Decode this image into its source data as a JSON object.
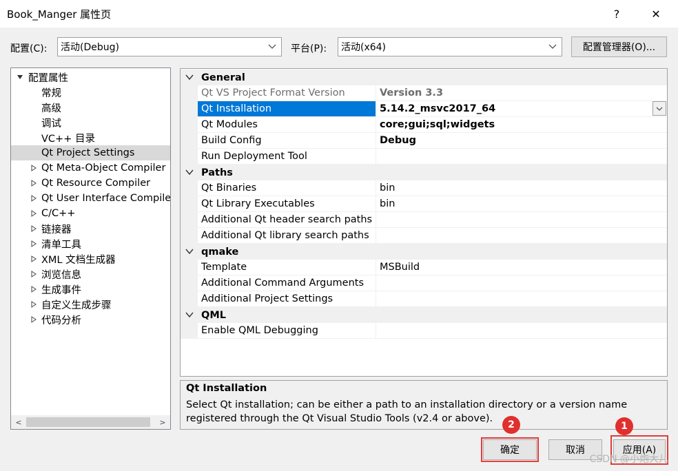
{
  "window": {
    "title": "Book_Manger 属性页",
    "help_label": "?",
    "close_label": "✕"
  },
  "config_bar": {
    "config_label": "配置(C):",
    "config_value": "活动(Debug)",
    "platform_label": "平台(P):",
    "platform_value": "活动(x64)",
    "manager_button": "配置管理器(O)..."
  },
  "tree": {
    "root": "配置属性",
    "items": [
      {
        "label": "常规",
        "expandable": false
      },
      {
        "label": "高级",
        "expandable": false
      },
      {
        "label": "调试",
        "expandable": false
      },
      {
        "label": "VC++ 目录",
        "expandable": false
      },
      {
        "label": "Qt Project Settings",
        "expandable": false,
        "selected": true
      },
      {
        "label": "Qt Meta-Object Compiler",
        "expandable": true
      },
      {
        "label": "Qt Resource Compiler",
        "expandable": true
      },
      {
        "label": "Qt User Interface Compile",
        "expandable": true
      },
      {
        "label": "C/C++",
        "expandable": true
      },
      {
        "label": "链接器",
        "expandable": true
      },
      {
        "label": "清单工具",
        "expandable": true
      },
      {
        "label": "XML 文档生成器",
        "expandable": true
      },
      {
        "label": "浏览信息",
        "expandable": true
      },
      {
        "label": "生成事件",
        "expandable": true
      },
      {
        "label": "自定义生成步骤",
        "expandable": true
      },
      {
        "label": "代码分析",
        "expandable": true
      }
    ]
  },
  "grid": {
    "categories": [
      {
        "name": "General",
        "rows": [
          {
            "name": "Qt VS Project Format Version",
            "value": "Version 3.3",
            "bold": true,
            "disabled": true
          },
          {
            "name": "Qt Installation",
            "value": "5.14.2_msvc2017_64",
            "bold": true,
            "selected": true
          },
          {
            "name": "Qt Modules",
            "value": "core;gui;sql;widgets",
            "bold": true
          },
          {
            "name": "Build Config",
            "value": "Debug",
            "bold": true
          },
          {
            "name": "Run Deployment Tool",
            "value": ""
          }
        ]
      },
      {
        "name": "Paths",
        "rows": [
          {
            "name": "Qt Binaries",
            "value": "bin"
          },
          {
            "name": "Qt Library Executables",
            "value": "bin"
          },
          {
            "name": "Additional Qt header search paths",
            "value": ""
          },
          {
            "name": "Additional Qt library search paths",
            "value": ""
          }
        ]
      },
      {
        "name": "qmake",
        "rows": [
          {
            "name": "Template",
            "value": "MSBuild"
          },
          {
            "name": "Additional Command Arguments",
            "value": ""
          },
          {
            "name": "Additional Project Settings",
            "value": ""
          }
        ]
      },
      {
        "name": "QML",
        "rows": [
          {
            "name": "Enable QML Debugging",
            "value": ""
          }
        ]
      }
    ]
  },
  "description": {
    "title": "Qt Installation",
    "text": "Select Qt installation; can be either a path to an installation directory or a version name registered through the Qt Visual Studio Tools (v2.4 or above)."
  },
  "footer": {
    "ok_label": "确定",
    "cancel_label": "取消",
    "apply_label": "应用(A)",
    "badge_ok": "2",
    "badge_apply": "1",
    "watermark": "CSDN @小炮大儿"
  },
  "colors": {
    "selection": "#0078d7",
    "annotation_red": "#e0302d"
  }
}
